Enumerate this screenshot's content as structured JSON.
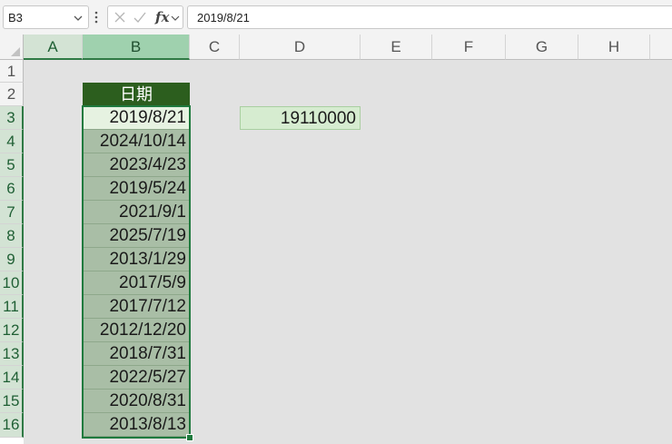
{
  "formula_bar": {
    "name_box": "B3",
    "cancel_icon": "cancel-icon",
    "enter_icon": "check-icon",
    "fx_label": "fx",
    "formula_value": "2019/8/21"
  },
  "columns": [
    "A",
    "B",
    "C",
    "D",
    "E",
    "F",
    "G",
    "H"
  ],
  "rows": [
    "1",
    "2",
    "3",
    "4",
    "5",
    "6",
    "7",
    "8",
    "9",
    "10",
    "11",
    "12",
    "13",
    "14",
    "15",
    "16"
  ],
  "sheet": {
    "header": "日期",
    "dates": [
      "2019/8/21",
      "2024/10/14",
      "2023/4/23",
      "2019/5/24",
      "2021/9/1",
      "2025/7/19",
      "2013/1/29",
      "2017/5/9",
      "2017/7/12",
      "2012/12/20",
      "2018/7/31",
      "2022/5/27",
      "2020/8/31",
      "2013/8/13"
    ],
    "d3_value": "19110000"
  },
  "colors": {
    "header_fill": "#2c5e1e",
    "date_fill": "#a9bea6",
    "d3_fill": "#d6ecd0",
    "selection_border": "#1f7a3e"
  }
}
